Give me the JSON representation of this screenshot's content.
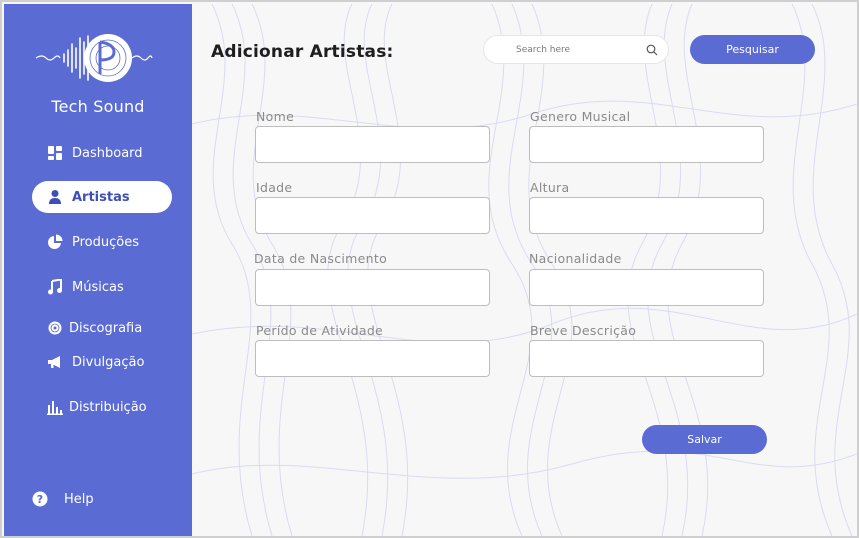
{
  "colors": {
    "accent": "#5a6bd3",
    "sidebar_bg": "#5a6bd3",
    "main_bg": "#f7f7f8",
    "active_text": "#3f4fb5"
  },
  "sidebar": {
    "brand": "Tech Sound",
    "logo_icon": "soundwave-vinyl-logo",
    "items": [
      {
        "label": "Dashboard",
        "icon": "dashboard-icon",
        "active": false
      },
      {
        "label": "Artistas",
        "icon": "user-icon",
        "active": true
      },
      {
        "label": "Produções",
        "icon": "pie-chart-icon",
        "active": false
      },
      {
        "label": "Músicas",
        "icon": "music-note-icon",
        "active": false
      },
      {
        "label": "Discografia",
        "icon": "disc-icon",
        "active": false
      },
      {
        "label": "Divulgação",
        "icon": "megaphone-icon",
        "active": false
      },
      {
        "label": "Distribuição",
        "icon": "bar-chart-icon",
        "active": false
      }
    ],
    "help": {
      "label": "Help",
      "icon": "help-circle-icon"
    }
  },
  "header": {
    "title": "Adicionar Artistas:",
    "search_placeholder": "Search here",
    "search_button": "Pesquisar"
  },
  "form": {
    "fields": [
      {
        "label": "Nome",
        "value": ""
      },
      {
        "label": "Genero Musical",
        "value": ""
      },
      {
        "label": "Idade",
        "value": ""
      },
      {
        "label": "Altura",
        "value": ""
      },
      {
        "label": "Data de Nascimento",
        "value": ""
      },
      {
        "label": "Nacionalidade",
        "value": ""
      },
      {
        "label": "Perído de Atividade",
        "value": ""
      },
      {
        "label": "Breve Descrição",
        "value": ""
      }
    ],
    "save_button": "Salvar"
  }
}
